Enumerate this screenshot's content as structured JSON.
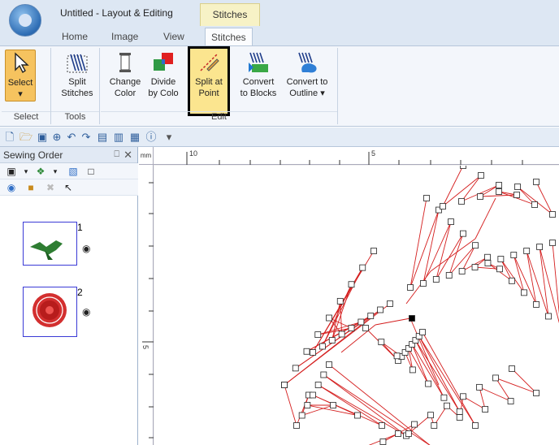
{
  "window": {
    "title": "Untitled - Layout & Editing",
    "context_tab": "Stitches"
  },
  "tabs": [
    {
      "label": "Home",
      "active": false
    },
    {
      "label": "Image",
      "active": false
    },
    {
      "label": "View",
      "active": false
    },
    {
      "label": "Stitches",
      "active": true
    }
  ],
  "ribbon": {
    "groups": {
      "select": "Select",
      "tools": "Tools",
      "edit": "Edit"
    },
    "buttons": {
      "select": "Select",
      "split_stitches": [
        "Split",
        "Stitches"
      ],
      "change_color": [
        "Change",
        "Color"
      ],
      "divide_by_color": [
        "Divide",
        "by Colo"
      ],
      "split_at_point": [
        "Split at",
        "Point"
      ],
      "convert_to_blocks": [
        "Convert",
        "to Blocks"
      ],
      "convert_to_outline": [
        "Convert to",
        "Outline ▾"
      ]
    }
  },
  "sewing_panel": {
    "title": "Sewing Order",
    "pin": "⎕",
    "close": "✕",
    "items": [
      {
        "number": "1",
        "color": "#2e7d32",
        "icon": "leaf-icon"
      },
      {
        "number": "2",
        "color": "#d32f2f",
        "icon": "rose-icon"
      }
    ]
  },
  "rulers": {
    "unit": "mm",
    "top_labels": [
      "10",
      "5"
    ],
    "left_labels": [
      "5"
    ]
  },
  "colors": {
    "accent": "#f6c35f",
    "stitch": "#d41d1d",
    "selected_point": "#000000"
  }
}
